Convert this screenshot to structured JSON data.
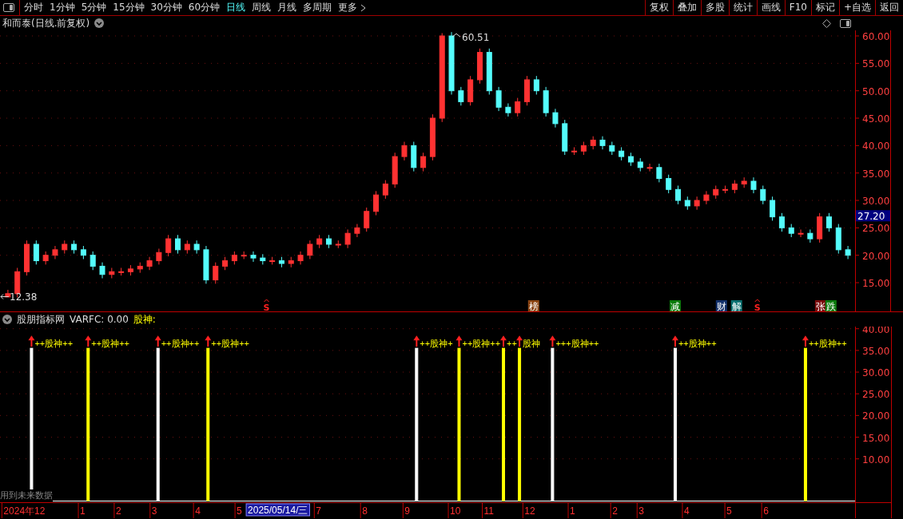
{
  "toolbar": {
    "tabs": [
      {
        "label": "分时",
        "selected": false
      },
      {
        "label": "1分钟",
        "selected": false
      },
      {
        "label": "5分钟",
        "selected": false
      },
      {
        "label": "15分钟",
        "selected": false
      },
      {
        "label": "30分钟",
        "selected": false
      },
      {
        "label": "60分钟",
        "selected": false
      },
      {
        "label": "日线",
        "selected": true
      },
      {
        "label": "周线",
        "selected": false
      },
      {
        "label": "月线",
        "selected": false
      },
      {
        "label": "多周期",
        "selected": false
      },
      {
        "label": "更多",
        "selected": false,
        "kind": "more"
      }
    ],
    "buttons": [
      "复权",
      "叠加",
      "多股",
      "统计",
      "画线",
      "F10",
      "标记",
      "+自选",
      "返回"
    ]
  },
  "title": "和而泰(日线.前复权)",
  "price_chart": {
    "chart_data": {
      "type": "candlestick",
      "categories": [
        null,
        null,
        null,
        null,
        null,
        null,
        null,
        null,
        null,
        null,
        null,
        null,
        null,
        null,
        null,
        null,
        null,
        null,
        null,
        null,
        null,
        null,
        null,
        null,
        null,
        null,
        null,
        null,
        null,
        null,
        null,
        null,
        null,
        null,
        null,
        null,
        null,
        null,
        null,
        null,
        null,
        null,
        null,
        null,
        null,
        null,
        null,
        null,
        null,
        null,
        null,
        null,
        null,
        null,
        null,
        null,
        null,
        null,
        null,
        null,
        null,
        null,
        null,
        null,
        null,
        null,
        null,
        null,
        null,
        null,
        null,
        null,
        null,
        null,
        null,
        null,
        null,
        null,
        null,
        null,
        null,
        null,
        null,
        null,
        null,
        null,
        null,
        null,
        null,
        null
      ],
      "ohlc": [
        [
          12.4,
          13.7,
          12.38,
          13
        ],
        [
          13,
          17.7,
          12.3,
          17
        ],
        [
          17,
          22.7,
          16.3,
          22
        ],
        [
          22,
          22.7,
          18.3,
          19
        ],
        [
          19,
          20.7,
          18.3,
          20
        ],
        [
          20,
          21.7,
          19.3,
          21
        ],
        [
          21,
          22.7,
          20.3,
          22
        ],
        [
          22,
          22.7,
          20.3,
          21
        ],
        [
          21,
          21.7,
          19.3,
          20
        ],
        [
          20,
          20.7,
          17.3,
          18
        ],
        [
          18,
          18.7,
          15.8,
          16.5
        ],
        [
          16.5,
          17.7,
          15.8,
          17
        ],
        [
          17,
          17.7,
          16.3,
          17
        ],
        [
          17,
          18.2,
          16.3,
          17.5
        ],
        [
          17.5,
          18.7,
          16.8,
          18
        ],
        [
          18,
          19.7,
          17.3,
          19
        ],
        [
          19,
          21.2,
          18.3,
          20.5
        ],
        [
          20.5,
          23.7,
          19.8,
          23
        ],
        [
          23,
          23.7,
          20.3,
          21
        ],
        [
          21,
          22.7,
          20.3,
          22
        ],
        [
          22,
          22.7,
          20.3,
          21
        ],
        [
          21,
          21.7,
          14.8,
          15.5
        ],
        [
          15.5,
          18.7,
          14.8,
          18
        ],
        [
          18,
          19.7,
          17.3,
          19
        ],
        [
          19,
          20.7,
          18.3,
          20
        ],
        [
          20,
          20.7,
          19.3,
          20
        ],
        [
          20,
          20.7,
          18.8,
          19.5
        ],
        [
          19.5,
          20.2,
          18.3,
          19
        ],
        [
          19,
          19.7,
          18.3,
          19
        ],
        [
          19,
          19.7,
          17.8,
          18.5
        ],
        [
          18.5,
          19.7,
          17.8,
          19
        ],
        [
          19,
          20.7,
          18.3,
          20
        ],
        [
          20,
          22.7,
          19.3,
          22
        ],
        [
          22,
          23.7,
          21.3,
          23
        ],
        [
          23,
          23.7,
          21.3,
          22
        ],
        [
          22,
          22.7,
          21.3,
          22
        ],
        [
          22,
          24.7,
          21.3,
          24
        ],
        [
          24,
          25.7,
          23.3,
          25
        ],
        [
          25,
          28.7,
          24.3,
          28
        ],
        [
          28,
          31.7,
          27.3,
          31
        ],
        [
          31,
          33.7,
          30.3,
          33
        ],
        [
          33,
          38.7,
          32.3,
          38
        ],
        [
          38,
          40.7,
          37.3,
          40
        ],
        [
          40,
          40.7,
          35.3,
          36
        ],
        [
          36,
          38.7,
          35.3,
          38
        ],
        [
          38,
          45.7,
          37.3,
          45
        ],
        [
          45,
          60.51,
          44.3,
          60
        ],
        [
          60,
          60.7,
          49.3,
          50
        ],
        [
          50,
          50.7,
          47.3,
          48
        ],
        [
          48,
          52.7,
          47.3,
          52
        ],
        [
          52,
          57.7,
          51.3,
          57
        ],
        [
          57,
          57.7,
          49.3,
          50
        ],
        [
          50,
          50.7,
          46.3,
          47
        ],
        [
          47,
          47.7,
          45.3,
          46
        ],
        [
          46,
          48.7,
          45.3,
          48
        ],
        [
          48,
          52.7,
          47.3,
          52
        ],
        [
          52,
          52.7,
          49.3,
          50
        ],
        [
          50,
          50.7,
          45.3,
          46
        ],
        [
          46,
          46.7,
          43.3,
          44
        ],
        [
          44,
          44.7,
          38.3,
          39
        ],
        [
          39,
          39.7,
          38.3,
          39
        ],
        [
          39,
          40.7,
          38.3,
          40
        ],
        [
          40,
          41.7,
          39.3,
          41
        ],
        [
          41,
          41.7,
          39.3,
          40
        ],
        [
          40,
          40.7,
          38.3,
          39
        ],
        [
          39,
          39.7,
          37.3,
          38
        ],
        [
          38,
          38.7,
          36.3,
          37
        ],
        [
          37,
          37.7,
          35.3,
          36
        ],
        [
          36,
          36.7,
          35.3,
          36
        ],
        [
          36,
          36.7,
          33.3,
          34
        ],
        [
          34,
          34.7,
          31.3,
          32
        ],
        [
          32,
          32.7,
          29.3,
          30
        ],
        [
          30,
          30.7,
          28.3,
          29
        ],
        [
          29,
          30.7,
          28.3,
          30
        ],
        [
          30,
          31.7,
          29.3,
          31
        ],
        [
          31,
          32.7,
          30.3,
          32
        ],
        [
          32,
          32.7,
          31.3,
          32
        ],
        [
          32,
          33.7,
          31.3,
          33
        ],
        [
          33,
          34.2,
          32.3,
          33.5
        ],
        [
          33.5,
          34.2,
          31.3,
          32
        ],
        [
          32,
          32.7,
          29.3,
          30
        ],
        [
          30,
          30.7,
          26.3,
          27
        ],
        [
          27,
          27.7,
          24.3,
          25
        ],
        [
          25,
          25.7,
          23.3,
          24
        ],
        [
          24,
          24.7,
          23.3,
          24
        ],
        [
          24,
          24.7,
          22.3,
          23
        ],
        [
          23,
          27.7,
          22.3,
          27
        ],
        [
          27,
          27.7,
          24.3,
          25
        ],
        [
          25,
          25.7,
          20.3,
          21
        ],
        [
          21,
          21.7,
          19.3,
          20
        ]
      ],
      "ylim": [
        9.76,
        61.02
      ],
      "grid": true,
      "yticks": [
        {
          "value": 15,
          "label": "15.00"
        },
        {
          "value": 20,
          "label": "20.00"
        },
        {
          "value": 25,
          "label": "25.00"
        },
        {
          "value": 30,
          "label": "30.00"
        },
        {
          "value": 35,
          "label": "35.00"
        },
        {
          "value": 40,
          "label": "40.00"
        },
        {
          "value": 45,
          "label": "45.00"
        },
        {
          "value": 50,
          "label": "50.00"
        },
        {
          "value": 55,
          "label": "55.00"
        },
        {
          "value": 60,
          "label": "60.00"
        }
      ],
      "annotations": [
        "60.51",
        "12.38"
      ]
    },
    "last_price": "27.20",
    "events": [
      {
        "text": "S",
        "kind": "s",
        "color": "#ff2020"
      },
      {
        "text": "榜",
        "kind": "tag",
        "color": "#8b4513"
      },
      {
        "text": "减",
        "kind": "tag",
        "color": "#0a7a0a"
      },
      {
        "text": "财",
        "kind": "tag",
        "color": "#12306a"
      },
      {
        "text": "解",
        "kind": "tag",
        "color": "#0a7070"
      },
      {
        "text": "S",
        "kind": "s",
        "color": "#ff2020"
      },
      {
        "text": "张",
        "kind": "tag",
        "color": "#7a0a0a"
      },
      {
        "text": "跌",
        "kind": "tag",
        "color": "#0a7a0a"
      }
    ]
  },
  "indicator": {
    "name": "股朋指标网",
    "reading": "VARFC: 0.00",
    "signal_name": "股神:",
    "signals": [
      {
        "label": "++股神++",
        "color": "#ffffff"
      },
      {
        "label": "++股神++",
        "color": "#ffff00"
      },
      {
        "label": "++股神++",
        "color": "#ffffff"
      },
      {
        "label": "++股神++",
        "color": "#ffff00"
      },
      {
        "label": "++股神+",
        "color": "#ffffff"
      },
      {
        "label": "++股神++",
        "color": "#ffff00"
      },
      {
        "label": "++",
        "color": "#ffff00"
      },
      {
        "label": "股神",
        "color": "#ffff00"
      },
      {
        "label": "+++股神++",
        "color": "#ffffff"
      },
      {
        "label": "++股神++",
        "color": "#ffffff"
      },
      {
        "label": "++股神++",
        "color": "#ffff00"
      }
    ],
    "axis_labels": [
      "40.00",
      "35.00",
      "30.00",
      "25.00",
      "20.00",
      "15.00",
      "10.00"
    ],
    "note": "用到未来数据"
  },
  "time_axis": [
    {
      "label": "2024年12",
      "selected": false
    },
    {
      "label": "1",
      "selected": false
    },
    {
      "label": "2",
      "selected": false
    },
    {
      "label": "3",
      "selected": false
    },
    {
      "label": "4",
      "selected": false
    },
    {
      "label": "5",
      "selected": false
    },
    {
      "label": "2025/05/14/三",
      "selected": true
    },
    {
      "label": "7",
      "selected": false
    },
    {
      "label": "8",
      "selected": false
    },
    {
      "label": "9",
      "selected": false
    },
    {
      "label": "10",
      "selected": false
    },
    {
      "label": "11",
      "selected": false
    },
    {
      "label": "12",
      "selected": false
    },
    {
      "label": "1",
      "selected": false
    },
    {
      "label": "2",
      "selected": false
    },
    {
      "label": "3",
      "selected": false
    },
    {
      "label": "4",
      "selected": false
    },
    {
      "label": "5",
      "selected": false
    },
    {
      "label": "6",
      "selected": false
    }
  ]
}
